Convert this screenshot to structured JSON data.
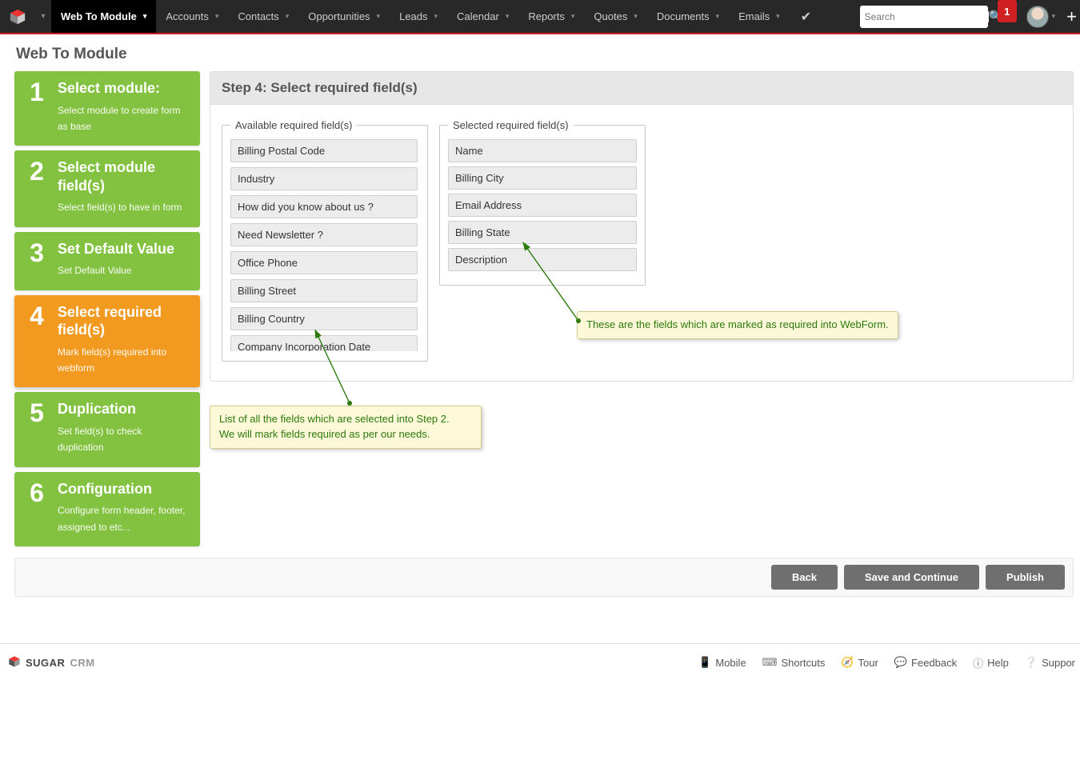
{
  "nav": {
    "items": [
      "Web To Module",
      "Accounts",
      "Contacts",
      "Opportunities",
      "Leads",
      "Calendar",
      "Reports",
      "Quotes",
      "Documents",
      "Emails"
    ],
    "active_index": 0,
    "search_placeholder": "Search",
    "notif_count": "1"
  },
  "page_title": "Web To Module",
  "steps": [
    {
      "num": "1",
      "title": "Select module:",
      "desc": "Select module to create form as base"
    },
    {
      "num": "2",
      "title": "Select module field(s)",
      "desc": "Select field(s) to have in form"
    },
    {
      "num": "3",
      "title": "Set Default Value",
      "desc": "Set Default Value"
    },
    {
      "num": "4",
      "title": "Select required field(s)",
      "desc": "Mark field(s) required into webform"
    },
    {
      "num": "5",
      "title": "Duplication",
      "desc": "Set field(s) to check duplication"
    },
    {
      "num": "6",
      "title": "Configuration",
      "desc": "Configure form header, footer, assigned to etc..."
    }
  ],
  "current_step_index": 3,
  "panel": {
    "heading": "Step 4: Select required field(s)",
    "available_legend": "Available required field(s)",
    "selected_legend": "Selected required field(s)",
    "available": [
      "Billing Postal Code",
      "Industry",
      "How did you know about us ?",
      "Need Newsletter ?",
      "Office Phone",
      "Billing Street",
      "Billing Country",
      "Company Incorporation Date"
    ],
    "selected": [
      "Name",
      "Billing City",
      "Email Address",
      "Billing State",
      "Description"
    ]
  },
  "callouts": {
    "available": "List of all the fields which are selected into Step 2.\nWe will mark fields required as per our needs.",
    "selected": "These are the fields which are marked as required into WebForm."
  },
  "buttons": {
    "back": "Back",
    "save": "Save and Continue",
    "publish": "Publish"
  },
  "footer": {
    "brand": "SUGAR",
    "brand_suffix": "CRM",
    "links": [
      "Mobile",
      "Shortcuts",
      "Tour",
      "Feedback",
      "Help",
      "Suppor"
    ]
  }
}
